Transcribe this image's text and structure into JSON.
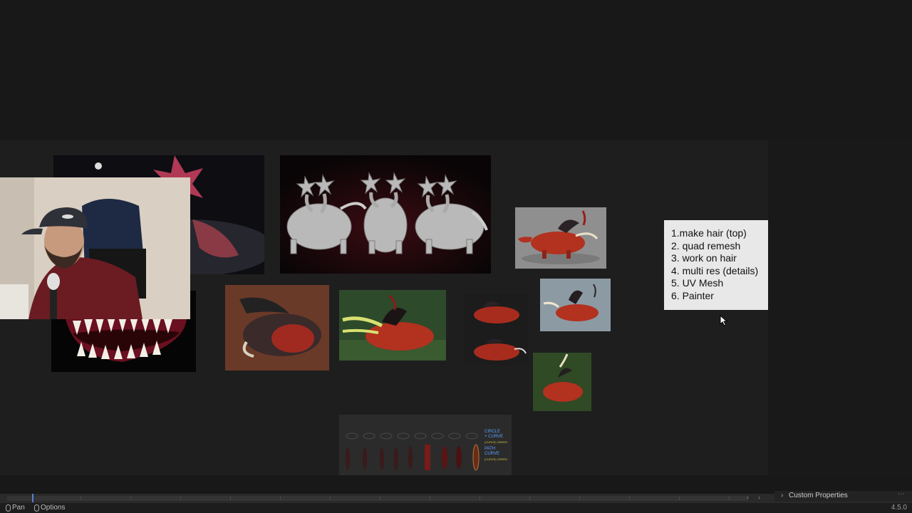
{
  "notes": {
    "items": [
      "1.make hair (top)",
      "2. quad remesh",
      "3. work on hair",
      "4. multi res (details)",
      "5. UV Mesh",
      "6. Painter"
    ]
  },
  "curve_sheet": {
    "labels": [
      "CIRCLE",
      "+ CURVE",
      "(CURVE) GREEN",
      "PATH",
      "CURVE",
      "(CURVE) GREEN"
    ]
  },
  "properties_panel": {
    "header": "Custom Properties"
  },
  "status_bar": {
    "pan_label": "Pan",
    "options_label": "Options",
    "version": "4.5.0"
  },
  "colors": {
    "background": "#181818",
    "board": "#1e1e1e",
    "note_paper": "#e8e8e8",
    "creature_red": "#b2311f",
    "accent_blue": "#5a7ecf"
  }
}
